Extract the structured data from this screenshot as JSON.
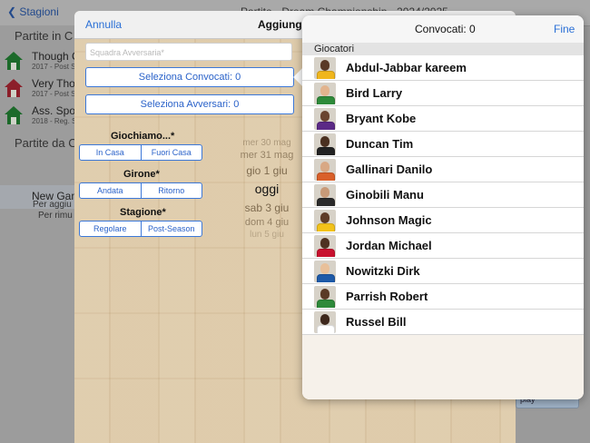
{
  "background": {
    "back_label": "Stagioni",
    "title": "Partite - Dream Championship - 2024/2025",
    "sections": [
      "Partite in C",
      "Partite da C"
    ],
    "games": [
      {
        "title": "Though C",
        "sub": "2017 - Post S",
        "roof": "#1c6a2a"
      },
      {
        "title": "Very Tho",
        "sub": "2017 - Post S",
        "roof": "#8c1f2a"
      },
      {
        "title": "Ass. Spor",
        "sub": "2018 - Reg. S",
        "roof": "#1c6a2a"
      }
    ],
    "new_game": "New Gam",
    "hints": [
      "Per aggiu",
      "Per rimu"
    ],
    "play": "play"
  },
  "sheet": {
    "cancel": "Annulla",
    "title": "Aggiungi N",
    "opponent_placeholder": "Squadra Avversaria*",
    "select_called_up": "Seleziona Convocati: 0",
    "select_opponents": "Seleziona Avversari: 0",
    "home_away": {
      "label": "Giochiamo...*",
      "options": [
        "In Casa",
        "Fuori Casa"
      ]
    },
    "round": {
      "label": "Girone*",
      "options": [
        "Andata",
        "Ritorno"
      ]
    },
    "season": {
      "label": "Stagione*",
      "options": [
        "Regolare",
        "Post-Season"
      ]
    },
    "dates": [
      "mer 30 mag",
      "mer 31 mag",
      "gio 1 giu",
      "oggi",
      "sab 3 giu",
      "dom 4 giu",
      "lun 5 giu"
    ],
    "selected_date": "oggi"
  },
  "popover": {
    "title": "Convocati: 0",
    "done": "Fine",
    "section": "Giocatori",
    "players": [
      {
        "name": "Abdul-Jabbar kareem",
        "jersey": "#f0b61c",
        "skin": "#5a3a26"
      },
      {
        "name": "Bird Larry",
        "jersey": "#2e8a3a",
        "skin": "#e2b48e"
      },
      {
        "name": "Bryant Kobe",
        "jersey": "#5b2a86",
        "skin": "#6a4430"
      },
      {
        "name": "Duncan Tim",
        "jersey": "#222222",
        "skin": "#4a3020"
      },
      {
        "name": "Gallinari Danilo",
        "jersey": "#d9602a",
        "skin": "#d8a884"
      },
      {
        "name": "Ginobili Manu",
        "jersey": "#2a2a2a",
        "skin": "#c89a78"
      },
      {
        "name": "Johnson Magic",
        "jersey": "#f2c21a",
        "skin": "#5e3c28"
      },
      {
        "name": "Jordan Michael",
        "jersey": "#c8102e",
        "skin": "#4e3222"
      },
      {
        "name": "Nowitzki Dirk",
        "jersey": "#1e5aa8",
        "skin": "#e8c09a"
      },
      {
        "name": "Parrish Robert",
        "jersey": "#2e8a3a",
        "skin": "#5a3a26"
      },
      {
        "name": "Russel Bill",
        "jersey": "#ffffff",
        "skin": "#3e281c"
      }
    ]
  }
}
